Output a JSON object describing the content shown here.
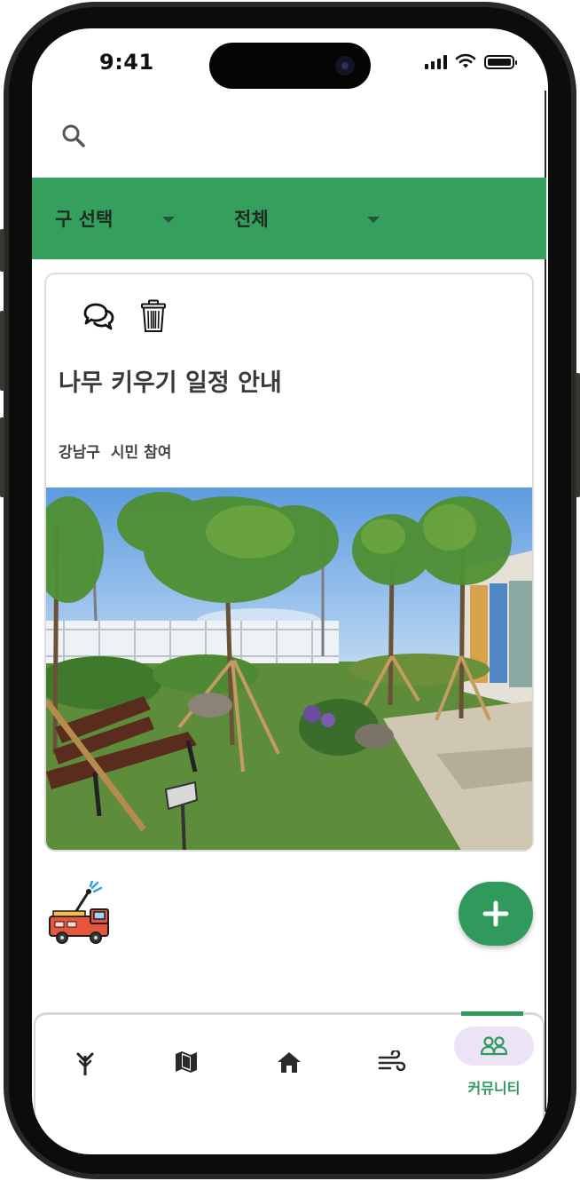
{
  "status_bar": {
    "time": "9:41"
  },
  "header": {
    "search_icon": "search-icon"
  },
  "filters": [
    {
      "label": "구 선택",
      "icon": "caret-down-icon"
    },
    {
      "label": "전체",
      "icon": "caret-down-icon"
    }
  ],
  "post": {
    "title": "나무 키우기 일정 안내",
    "district": "강남구",
    "category": "시민 참여",
    "icons": [
      "comments-icon",
      "trash-icon"
    ]
  },
  "fab": {
    "icon": "plus-icon"
  },
  "bottom_nav": {
    "items": [
      {
        "icon": "tree-sprout-icon",
        "active": false
      },
      {
        "icon": "map-icon",
        "active": false
      },
      {
        "icon": "home-icon",
        "active": false
      },
      {
        "icon": "wind-icon",
        "active": false
      },
      {
        "icon": "people-icon",
        "label": "커뮤니티",
        "active": true
      }
    ]
  },
  "colors": {
    "accent": "#359f5e",
    "fab": "#2f9a5c",
    "active_pill": "#ece4f4"
  }
}
